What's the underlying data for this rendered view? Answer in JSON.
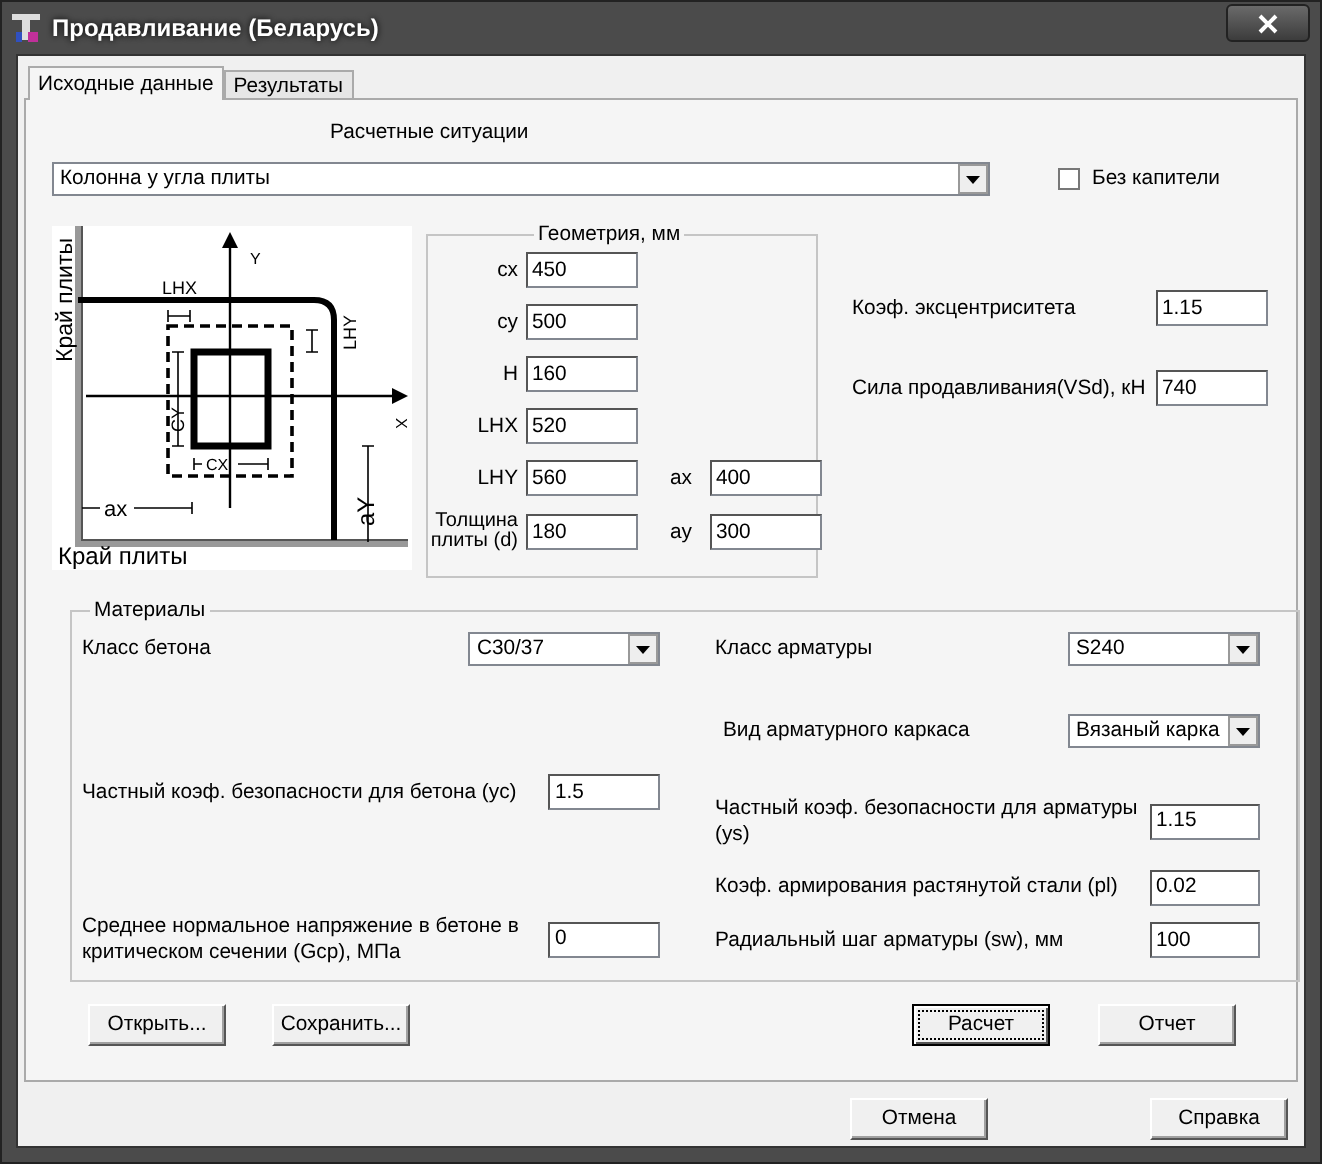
{
  "window": {
    "title": "Продавливание (Беларусь)"
  },
  "tabs": [
    {
      "label": "Исходные данные",
      "selected": true
    },
    {
      "label": "Результаты",
      "selected": false
    }
  ],
  "situation": {
    "label": "Расчетные ситуации",
    "value": "Колонна у угла плиты"
  },
  "no_capital": {
    "label": "Без капители",
    "checked": false
  },
  "diagram": {
    "labels": [
      "Край плиты",
      "Y",
      "LHX",
      "LHY",
      "X",
      "CY",
      "CX",
      "ax",
      "aY",
      "Край плиты"
    ]
  },
  "geometry": {
    "title": "Геометрия, мм",
    "fields": [
      {
        "label": "cx",
        "value": "450"
      },
      {
        "label": "cy",
        "value": "500"
      },
      {
        "label": "H",
        "value": "160"
      },
      {
        "label": "LHX",
        "value": "520"
      },
      {
        "label": "LHY",
        "value": "560"
      },
      {
        "label": "Толщина плиты (d)",
        "value": "180"
      }
    ],
    "side_fields": [
      {
        "label": "ax",
        "value": "400"
      },
      {
        "label": "ay",
        "value": "300"
      }
    ]
  },
  "loads": [
    {
      "label": "Коэф. эксцентриситета",
      "value": "1.15"
    },
    {
      "label": "Сила продавливания(VSd), кН",
      "value": "740"
    }
  ],
  "materials": {
    "title": "Материалы",
    "left": [
      {
        "kind": "select",
        "label": "Класс бетона",
        "value": "C30/37"
      },
      {
        "kind": "input",
        "label": "Частный коэф. безопасности для бетона (yc)",
        "value": "1.5"
      },
      {
        "kind": "input",
        "label": "Среднее нормальное напряжение в бетоне в критическом сечении (Gcp), МПа",
        "value": "0"
      }
    ],
    "right": [
      {
        "kind": "select",
        "label": "Класс арматуры",
        "value": "S240"
      },
      {
        "kind": "select",
        "label": "Вид арматурного каркаса",
        "value": "Вязаный карка"
      },
      {
        "kind": "input",
        "label": "Частный коэф. безопасности для арматуры (ys)",
        "value": "1.15"
      },
      {
        "kind": "input",
        "label": "Коэф. армирования растянутой стали (pl)",
        "value": "0.02"
      },
      {
        "kind": "input",
        "label": "Радиальный шаг  арматуры (sw), мм",
        "value": "100"
      }
    ]
  },
  "panel_buttons": [
    {
      "label": "Открыть...",
      "focused": false
    },
    {
      "label": "Сохранить...",
      "focused": false
    },
    {
      "label": "Расчет",
      "focused": true
    },
    {
      "label": "Отчет",
      "focused": false
    }
  ],
  "dialog_buttons": [
    {
      "label": "Отмена"
    },
    {
      "label": "Справка"
    }
  ]
}
